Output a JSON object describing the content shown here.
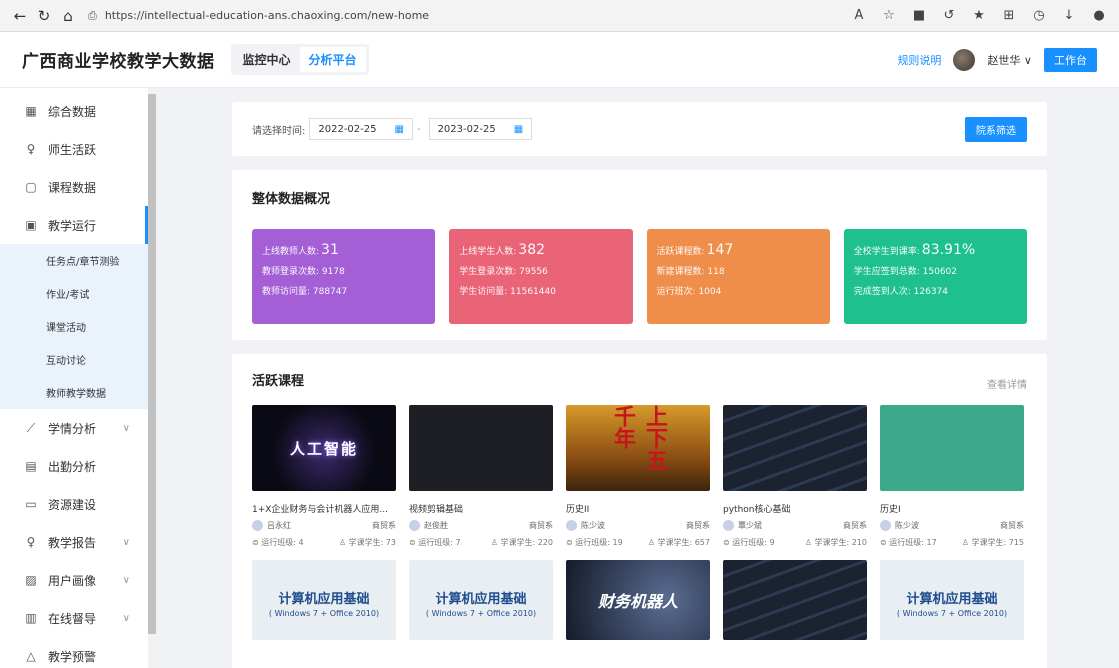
{
  "browser": {
    "url": "https://intellectual-education-ans.chaoxing.com/new-home"
  },
  "header": {
    "title": "广西商业学校教学大数据",
    "tabs": [
      {
        "label": "监控中心"
      },
      {
        "label": "分析平台"
      }
    ],
    "rules_link": "规则说明",
    "user_name": "赵世华 ∨",
    "work_button": "工作台"
  },
  "sidebar": {
    "items": [
      {
        "label": "综合数据",
        "icon": "grid-icon"
      },
      {
        "label": "师生活跃",
        "icon": "person-icon"
      },
      {
        "label": "课程数据",
        "icon": "book-icon"
      },
      {
        "label": "教学运行",
        "icon": "monitor-icon"
      }
    ],
    "sub_items": [
      {
        "label": "任务点/章节测验"
      },
      {
        "label": "作业/考试"
      },
      {
        "label": "课堂活动"
      },
      {
        "label": "互动讨论"
      },
      {
        "label": "教师教学数据"
      }
    ],
    "items_after": [
      {
        "label": "学情分析",
        "icon": "chart-icon",
        "arrow": "∨"
      },
      {
        "label": "出勤分析",
        "icon": "calendar-icon",
        "arrow": ""
      },
      {
        "label": "资源建设",
        "icon": "folder-icon",
        "arrow": ""
      },
      {
        "label": "教学报告",
        "icon": "person-icon",
        "arrow": "∨"
      },
      {
        "label": "用户画像",
        "icon": "image-icon",
        "arrow": "∨"
      },
      {
        "label": "在线督导",
        "icon": "doc-icon",
        "arrow": "∨"
      },
      {
        "label": "教学预警",
        "icon": "bell-icon",
        "arrow": ""
      }
    ]
  },
  "filter": {
    "label": "请选择时间:",
    "start_date": "2022-02-25",
    "end_date": "2023-02-25",
    "separator": "-",
    "button": "院系筛选"
  },
  "overview": {
    "title": "整体数据概况",
    "cards": [
      {
        "color": "#a45fd6",
        "l1": "上线教师人数:",
        "v1": "31",
        "l2": "教师登录次数:",
        "v2": "9178",
        "l3": "教师访问量:",
        "v3": "788747"
      },
      {
        "color": "#ea6477",
        "l1": "上线学生人数:",
        "v1": "382",
        "l2": "学生登录次数:",
        "v2": "79556",
        "l3": "学生访问量:",
        "v3": "11561440"
      },
      {
        "color": "#ef8d4b",
        "l1": "活跃课程数:",
        "v1": "147",
        "l2": "新建课程数:",
        "v2": "118",
        "l3": "运行班次:",
        "v3": "1004"
      },
      {
        "color": "#1ec08d",
        "l1": "全校学生到课率:",
        "v1": "83.91%",
        "l2": "学生应签到总数:",
        "v2": "150602",
        "l3": "完成签到人次:",
        "v3": "126374"
      }
    ]
  },
  "active_courses": {
    "title": "活跃课程",
    "detail_link": "查看详情",
    "row1": [
      {
        "name": "1+X企业财务与会计机器人应用...",
        "teacher": "吕永红",
        "dept": "商贸系",
        "classes_label": "运行班级:",
        "classes": "4",
        "students_label": "学课学生:",
        "students": "73",
        "thumb_text": "人工智能"
      },
      {
        "name": "视频剪辑基础",
        "teacher": "赵俊胜",
        "dept": "商贸系",
        "classes_label": "运行班级:",
        "classes": "7",
        "students_label": "学课学生:",
        "students": "220",
        "thumb_text": ""
      },
      {
        "name": "历史II",
        "teacher": "陈少波",
        "dept": "商贸系",
        "classes_label": "运行班级:",
        "classes": "19",
        "students_label": "学课学生:",
        "students": "657",
        "thumb_text": "上下五千年"
      },
      {
        "name": "python核心基础",
        "teacher": "覃少斌",
        "dept": "商贸系",
        "classes_label": "运行班级:",
        "classes": "9",
        "students_label": "学课学生:",
        "students": "210",
        "thumb_text": ""
      },
      {
        "name": "历史I",
        "teacher": "陈少波",
        "dept": "商贸系",
        "classes_label": "运行班级:",
        "classes": "17",
        "students_label": "学课学生:",
        "students": "715",
        "thumb_text": ""
      }
    ],
    "row2": [
      {
        "title": "计算机应用基础",
        "sub": "( Windows 7 + Office 2010)"
      },
      {
        "title": "计算机应用基础",
        "sub": "( Windows 7 + Office 2010)"
      },
      {
        "title": "财务机器人",
        "sub": ""
      },
      {
        "title": "",
        "sub": ""
      },
      {
        "title": "计算机应用基础",
        "sub": "( Windows 7 + Office 2010)"
      }
    ]
  }
}
